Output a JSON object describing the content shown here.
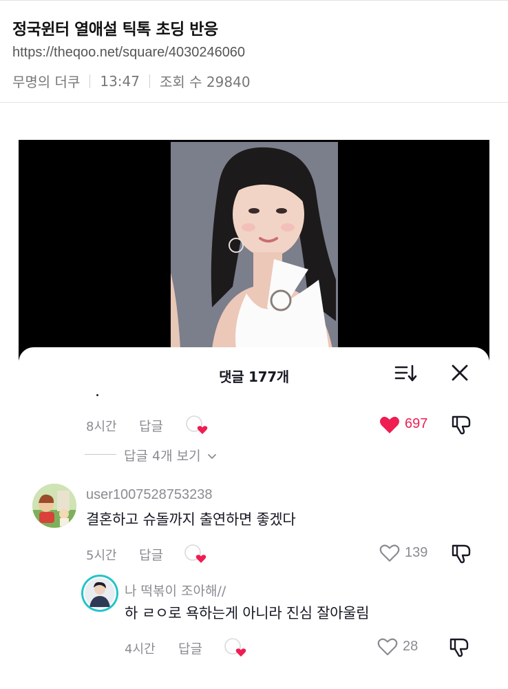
{
  "post": {
    "title": "정국윈터 열애설 틱톡 초딩 반응",
    "url": "https://theqoo.net/square/4030246060",
    "author": "무명의 더쿠",
    "time": "13:47",
    "views": "조회 수 29840"
  },
  "comments_panel": {
    "title": "댓글 177개"
  },
  "comments": [
    {
      "time": "8시간",
      "reply_label": "답글",
      "likes": "697",
      "liked": true,
      "more_replies": "답글 4개 보기"
    },
    {
      "username": "user1007528753238",
      "text": "결혼하고 슈돌까지 출연하면 좋겠다",
      "time": "5시간",
      "reply_label": "답글",
      "likes": "139"
    },
    {
      "username": "나 떡볶이 조아해//",
      "text": "하 ㄹㅇ로 욕하는게 아니라 진심 잘아울림",
      "time": "4시간",
      "reply_label": "답글",
      "likes": "28"
    }
  ],
  "colors": {
    "like_red": "#ee1d52",
    "meta_gray": "#8a8b91"
  }
}
